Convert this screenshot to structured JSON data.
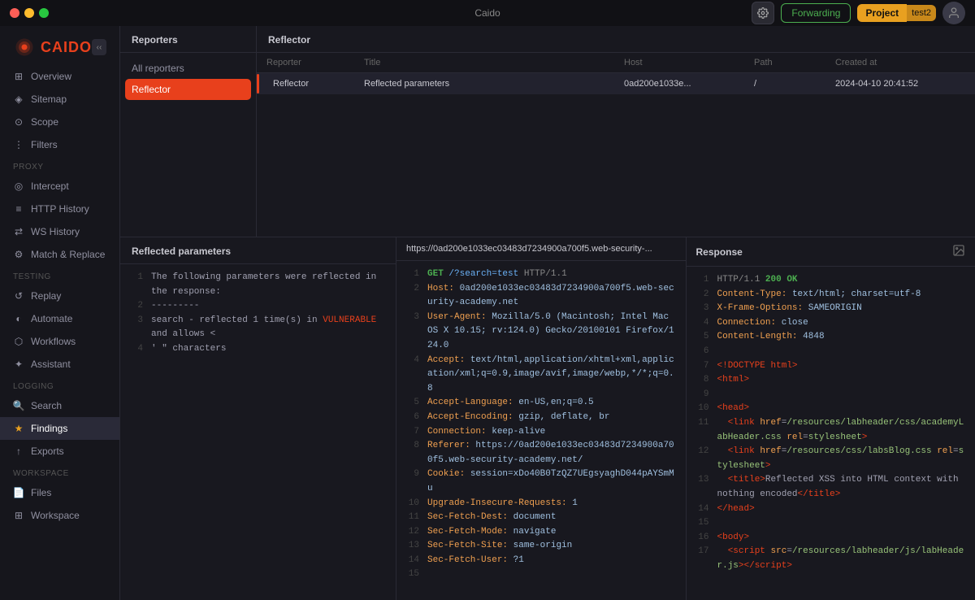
{
  "titlebar": {
    "title": "Caido",
    "forwarding_label": "Forwarding",
    "project_label": "Project",
    "project_name": "test2"
  },
  "sidebar": {
    "overview_label": "Overview",
    "sitemap_label": "Sitemap",
    "scope_label": "Scope",
    "filters_label": "Filters",
    "proxy_label": "Proxy",
    "intercept_label": "Intercept",
    "http_history_label": "HTTP History",
    "ws_history_label": "WS History",
    "match_replace_label": "Match & Replace",
    "testing_label": "Testing",
    "replay_label": "Replay",
    "automate_label": "Automate",
    "workflows_label": "Workflows",
    "assistant_label": "Assistant",
    "logging_label": "Logging",
    "search_label": "Search",
    "findings_label": "Findings",
    "exports_label": "Exports",
    "workspace_label": "Workspace",
    "files_label": "Files",
    "workspace2_label": "Workspace"
  },
  "reporters": {
    "header": "Reporters",
    "all_reporters": "All reporters",
    "reflector": "Reflector"
  },
  "reflector_table": {
    "header": "Reflector",
    "col_reporter": "Reporter",
    "col_title": "Title",
    "col_host": "Host",
    "col_path": "Path",
    "col_created": "Created at",
    "row": {
      "reporter": "Reflector",
      "title": "Reflected parameters",
      "host": "0ad200e1033e...",
      "path": "/",
      "created": "2024-04-10 20:41:52"
    }
  },
  "reflected_params": {
    "header": "Reflected parameters",
    "lines": [
      "The following parameters were reflected in the response:",
      "---------",
      "search - reflected 1 time(s) in VULNERABLE and allows <",
      "' \" characters",
      ""
    ]
  },
  "request": {
    "url": "https://0ad200e1033ec03483d7234900a700f5.web-security-...",
    "lines": [
      {
        "num": 1,
        "html": "<span class='syn-method'>GET</span> <span class='syn-path'>/?search=test</span> <span class='syn-http'>HTTP/1.1</span>"
      },
      {
        "num": 2,
        "html": "<span class='syn-key'>Host:</span> <span class='syn-val'>0ad200e1033ec03483d7234900a700f5.web-security-academy.net</span>"
      },
      {
        "num": 3,
        "html": "<span class='syn-key'>User-Agent:</span> <span class='syn-val'>Mozilla/5.0 (Macintosh; Intel Mac OS X 10.15; rv:124.0) Gecko/20100101 Firefox/124.0</span>"
      },
      {
        "num": 4,
        "html": "<span class='syn-key'>Accept:</span> <span class='syn-val'>text/html,application/xhtml+xml,application/xml;q=0.9,image/avif,image/webp,*/*;q=0.8</span>"
      },
      {
        "num": 5,
        "html": "<span class='syn-key'>Accept-Language:</span> <span class='syn-val'>en-US,en;q=0.5</span>"
      },
      {
        "num": 6,
        "html": "<span class='syn-key'>Accept-Encoding:</span> <span class='syn-val'>gzip, deflate, br</span>"
      },
      {
        "num": 7,
        "html": "<span class='syn-key'>Connection:</span> <span class='syn-val'>keep-alive</span>"
      },
      {
        "num": 8,
        "html": "<span class='syn-key'>Referer:</span> <span class='syn-val'>https://0ad200e1033ec03483d7234900a700f5.web-security-academy.net/</span>"
      },
      {
        "num": 9,
        "html": "<span class='syn-key'>Cookie:</span> <span class='syn-val'>session=xDo40B0TzQZ7UEgsyaghD044pAYSmMu</span>"
      },
      {
        "num": 10,
        "html": "<span class='syn-key'>Upgrade-Insecure-Requests:</span> <span class='syn-val'>1</span>"
      },
      {
        "num": 11,
        "html": "<span class='syn-key'>Sec-Fetch-Dest:</span> <span class='syn-val'>document</span>"
      },
      {
        "num": 12,
        "html": "<span class='syn-key'>Sec-Fetch-Mode:</span> <span class='syn-val'>navigate</span>"
      },
      {
        "num": 13,
        "html": "<span class='syn-key'>Sec-Fetch-Site:</span> <span class='syn-val'>same-origin</span>"
      },
      {
        "num": 14,
        "html": "<span class='syn-key'>Sec-Fetch-User:</span> <span class='syn-val'>?1</span>"
      },
      {
        "num": 15,
        "html": ""
      }
    ]
  },
  "response": {
    "header": "Response",
    "lines": [
      {
        "num": 1,
        "html": "<span class='syn-http'>HTTP/1.1</span> <span class='syn-status-ok'>200 OK</span>"
      },
      {
        "num": 2,
        "html": "<span class='syn-key'>Content-Type:</span> <span class='syn-val'>text/html; charset=utf-8</span>"
      },
      {
        "num": 3,
        "html": "<span class='syn-key'>X-Frame-Options:</span> <span class='syn-val'>SAMEORIGIN</span>"
      },
      {
        "num": 4,
        "html": "<span class='syn-key'>Connection:</span> <span class='syn-val'>close</span>"
      },
      {
        "num": 5,
        "html": "<span class='syn-key'>Content-Length:</span> <span class='syn-val'>4848</span>"
      },
      {
        "num": 6,
        "html": ""
      },
      {
        "num": 7,
        "html": "<span class='syn-tag'>&lt;!DOCTYPE html&gt;</span>"
      },
      {
        "num": 8,
        "html": "<span class='syn-tag'>&lt;html&gt;</span>"
      },
      {
        "num": 9,
        "html": ""
      },
      {
        "num": 10,
        "html": "<span class='syn-tag'>&lt;head&gt;</span>"
      },
      {
        "num": 11,
        "html": "  <span class='syn-tag'>&lt;link</span> <span class='syn-attr'>href</span>=<span class='syn-str'>/resources/labheader/css/academyLabHeader.css</span> <span class='syn-attr'>rel</span>=<span class='syn-str'>stylesheet</span><span class='syn-tag'>&gt;</span>"
      },
      {
        "num": 12,
        "html": "  <span class='syn-tag'>&lt;link</span> <span class='syn-attr'>href</span>=<span class='syn-str'>/resources/css/labsBlog.css</span> <span class='syn-attr'>rel</span>=<span class='syn-str'>stylesheet</span><span class='syn-tag'>&gt;</span>"
      },
      {
        "num": 13,
        "html": "  <span class='syn-tag'>&lt;title&gt;</span>Reflected XSS into HTML context with nothing encoded<span class='syn-tag'>&lt;/title&gt;</span>"
      },
      {
        "num": 14,
        "html": "<span class='syn-tag'>&lt;/head&gt;</span>"
      },
      {
        "num": 15,
        "html": ""
      },
      {
        "num": 16,
        "html": "<span class='syn-tag'>&lt;body&gt;</span>"
      },
      {
        "num": 17,
        "html": "  <span class='syn-tag'>&lt;script</span> <span class='syn-attr'>src</span>=<span class='syn-str'>/resources/labheader/js/labHeader.js</span><span class='syn-tag'>&gt;&lt;/script&gt;</span>"
      }
    ]
  }
}
